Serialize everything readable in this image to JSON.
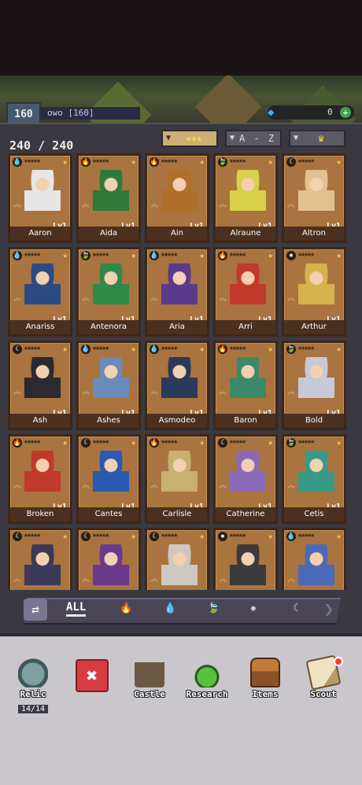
{
  "header": {
    "level": "160",
    "player_name": "owo [160]",
    "gems": "0",
    "gem_plus": "+"
  },
  "collection": {
    "count": "240 / 240",
    "sort_buttons": [
      {
        "label": "★★★",
        "active": true
      },
      {
        "label": "A - Z",
        "active": false
      },
      {
        "label": "♛",
        "active": false
      }
    ]
  },
  "heroes": [
    {
      "name": "Aaron",
      "level": "Lv1",
      "element": "💧",
      "color": "#e6e6e6"
    },
    {
      "name": "Aida",
      "level": "Lv1",
      "element": "🔥",
      "color": "#2f7a3a"
    },
    {
      "name": "Ain",
      "level": "Lv1",
      "element": "🔥",
      "color": "#b0702a"
    },
    {
      "name": "Alraune",
      "level": "Lv1",
      "element": "🍃",
      "color": "#d6d04a"
    },
    {
      "name": "Altron",
      "level": "Lv1",
      "element": "☾",
      "color": "#e4c090"
    },
    {
      "name": "Anariss",
      "level": "Lv1",
      "element": "💧",
      "color": "#2c4a82"
    },
    {
      "name": "Antenora",
      "level": "Lv1",
      "element": "🍃",
      "color": "#2f8a4a"
    },
    {
      "name": "Aria",
      "level": "Lv1",
      "element": "💧",
      "color": "#5a3a8a"
    },
    {
      "name": "Arri",
      "level": "Lv1",
      "element": "🔥",
      "color": "#c0392b"
    },
    {
      "name": "Arthur",
      "level": "Lv1",
      "element": "✹",
      "color": "#d6b24a"
    },
    {
      "name": "Ash",
      "level": "Lv1",
      "element": "☾",
      "color": "#2a2a30"
    },
    {
      "name": "Ashes",
      "level": "Lv1",
      "element": "💧",
      "color": "#6a8ab8"
    },
    {
      "name": "Asmodeo",
      "level": "Lv1",
      "element": "💧",
      "color": "#2a3a5a"
    },
    {
      "name": "Baron",
      "level": "Lv1",
      "element": "🔥",
      "color": "#3a8a6a"
    },
    {
      "name": "Bold",
      "level": "Lv1",
      "element": "🍃",
      "color": "#c8c8d8"
    },
    {
      "name": "Broken",
      "level": "Lv1",
      "element": "🔥",
      "color": "#c0392b"
    },
    {
      "name": "Cantes",
      "level": "Lv1",
      "element": "☾",
      "color": "#2a5ab0"
    },
    {
      "name": "Carlisle",
      "level": "Lv1",
      "element": "🔥",
      "color": "#c8b070"
    },
    {
      "name": "Catherine",
      "level": "Lv1",
      "element": "☾",
      "color": "#8a6ab8"
    },
    {
      "name": "Cetis",
      "level": "Lv1",
      "element": "🍃",
      "color": "#3a9a8a"
    },
    {
      "name": "",
      "level": "",
      "element": "☾",
      "color": "#3a3a58"
    },
    {
      "name": "",
      "level": "",
      "element": "☾",
      "color": "#6a3a8a"
    },
    {
      "name": "",
      "level": "",
      "element": "☾",
      "color": "#d0c8c0"
    },
    {
      "name": "",
      "level": "",
      "element": "✹",
      "color": "#3a3a3a"
    },
    {
      "name": "",
      "level": "",
      "element": "💧",
      "color": "#4a6ab8"
    }
  ],
  "filters": {
    "swap": "⇄",
    "all": "ALL",
    "elements": [
      "🔥",
      "💧",
      "🍃",
      "✹",
      "☾"
    ],
    "next": "❯"
  },
  "bottom_nav": {
    "relic": {
      "label": "Relic",
      "count": "14/14"
    },
    "close": "✖",
    "castle": "Castle",
    "research": "Research",
    "items": "Items",
    "scout": "Scout"
  }
}
